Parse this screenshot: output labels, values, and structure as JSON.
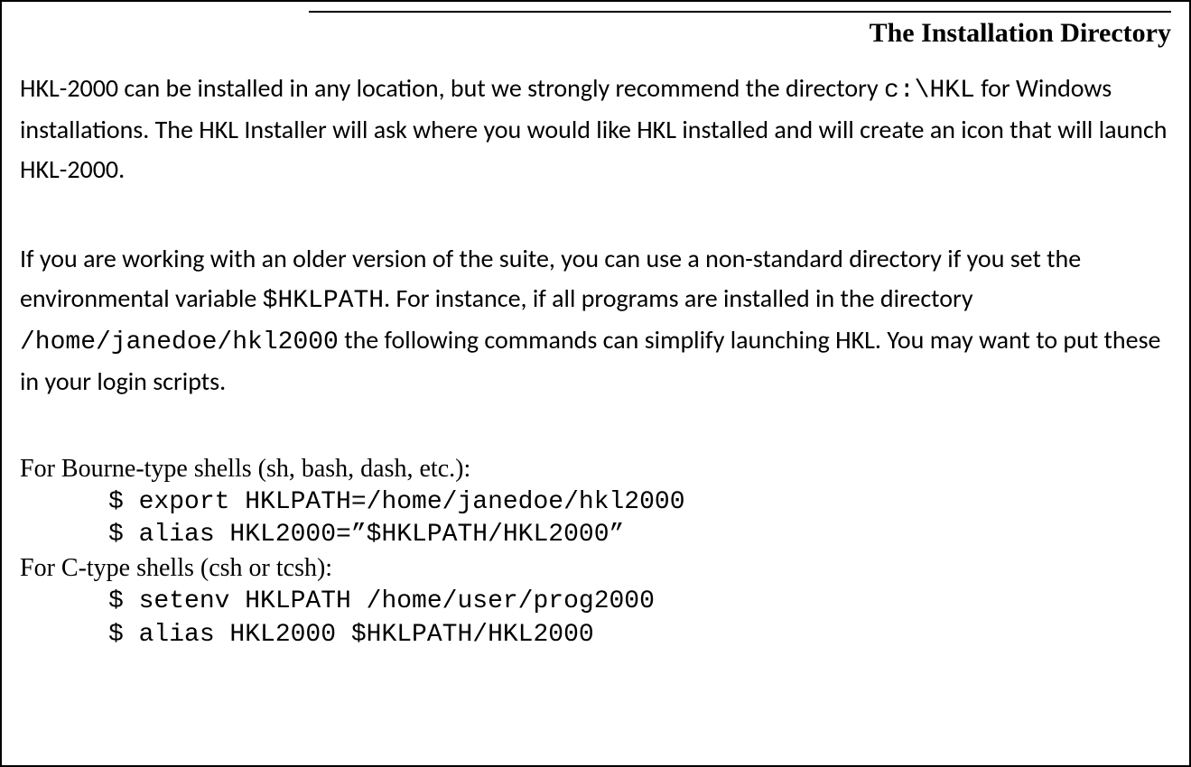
{
  "title": "The Installation Directory",
  "para1_part1": "HKL-2000 can be installed in any location, but we strongly recommend the directory ",
  "para1_code1": "c:\\HKL",
  "para1_part2": " for Windows installations. The HKL Installer will ask where you would like HKL installed and will create an icon that will launch HKL-2000.",
  "para2_part1": "If you are working with an older version of the suite, you can use a non-standard directory if you set the environmental variable ",
  "para2_code1": "$HKLPATH",
  "para2_part2": ". For instance, if all programs are installed in the directory ",
  "para2_code2": "/home/janedoe/hkl2000",
  "para2_part3": " the following commands can simplify launching HKL. You may want to put these in your login scripts.",
  "shell1_heading": "For Bourne-type shells (sh, bash, dash, etc.):",
  "shell1_line1": "$ export HKLPATH=/home/janedoe/hkl2000",
  "shell1_line2": "$ alias HKL2000=”$HKLPATH/HKL2000”",
  "shell2_heading": "For C-type shells (csh or tcsh):",
  "shell2_line1": "$ setenv HKLPATH /home/user/prog2000",
  "shell2_line2": "$ alias HKL2000 $HKLPATH/HKL2000"
}
